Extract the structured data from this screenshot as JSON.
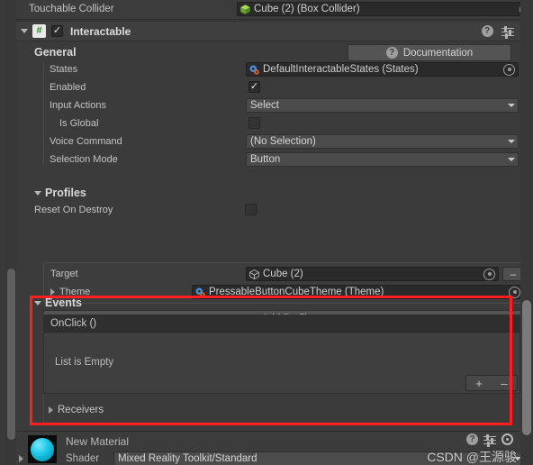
{
  "collider_row": {
    "label": "Touchable Collider",
    "value": "Cube (2) (Box Collider)",
    "icon": "box-collider-cube-icon"
  },
  "component_header": {
    "title": "Interactable",
    "script_glyph": "#",
    "enabled_check": "✓",
    "foldout": "expanded",
    "icons": [
      "help-icon",
      "preset-sliders-icon",
      "kebab-menu-icon"
    ],
    "help_glyph": "?"
  },
  "general": {
    "title": "General",
    "documentation_button": "Documentation",
    "doc_help_glyph": "?",
    "fields": [
      {
        "label": "States",
        "type": "object",
        "value": "DefaultInteractableStates (States)",
        "icon": "scriptable-object-icon"
      },
      {
        "label": "Enabled",
        "type": "checkbox",
        "checked": true,
        "check_glyph": "✓"
      },
      {
        "label": "Input Actions",
        "type": "dropdown",
        "value": "Select"
      },
      {
        "label": "Is Global",
        "type": "checkbox",
        "checked": false,
        "indent": true
      },
      {
        "label": "Voice Command",
        "type": "dropdown",
        "value": "(No Selection)"
      },
      {
        "label": "Selection Mode",
        "type": "dropdown",
        "value": "Button"
      }
    ]
  },
  "profiles": {
    "title": "Profiles",
    "foldout": "expanded",
    "reset_on_destroy": {
      "label": "Reset On Destroy",
      "checked": false
    },
    "target": {
      "label": "Target",
      "value": "Cube (2)",
      "icon": "gameobject-cube-icon",
      "remove_label": "–"
    },
    "theme": {
      "label": "Theme",
      "value": "PressableButtonCubeTheme (Theme)",
      "icon": "scriptable-object-icon",
      "foldout": "collapsed"
    },
    "add_profile_button": "Add Profile"
  },
  "events": {
    "title": "Events",
    "foldout": "expanded",
    "onclick_header": "OnClick ()",
    "list_empty_text": "List is Empty",
    "add_button": "+",
    "remove_button": "–",
    "receivers": {
      "label": "Receivers",
      "foldout": "collapsed"
    },
    "highlight_color": "#ff1f1f"
  },
  "material": {
    "name": "New Material",
    "shader_label": "Shader",
    "shader_value": "Mixed Reality Toolkit/Standard",
    "preview": "material-sphere-preview"
  },
  "watermark": {
    "text": "CSDN @王源骏"
  },
  "theme_colors": {
    "panel_bg": "#3b3b3b",
    "header_bg": "#3f3f3f",
    "field_bg": "#2a2a2a",
    "dropdown_bg": "#4b4b4b",
    "text": "#c4c4c4",
    "accent_red": "#ff1f1f",
    "script_green": "#2d8a2d",
    "collider_green": "#8cc63f",
    "material_cyan": "#22cbe8"
  }
}
